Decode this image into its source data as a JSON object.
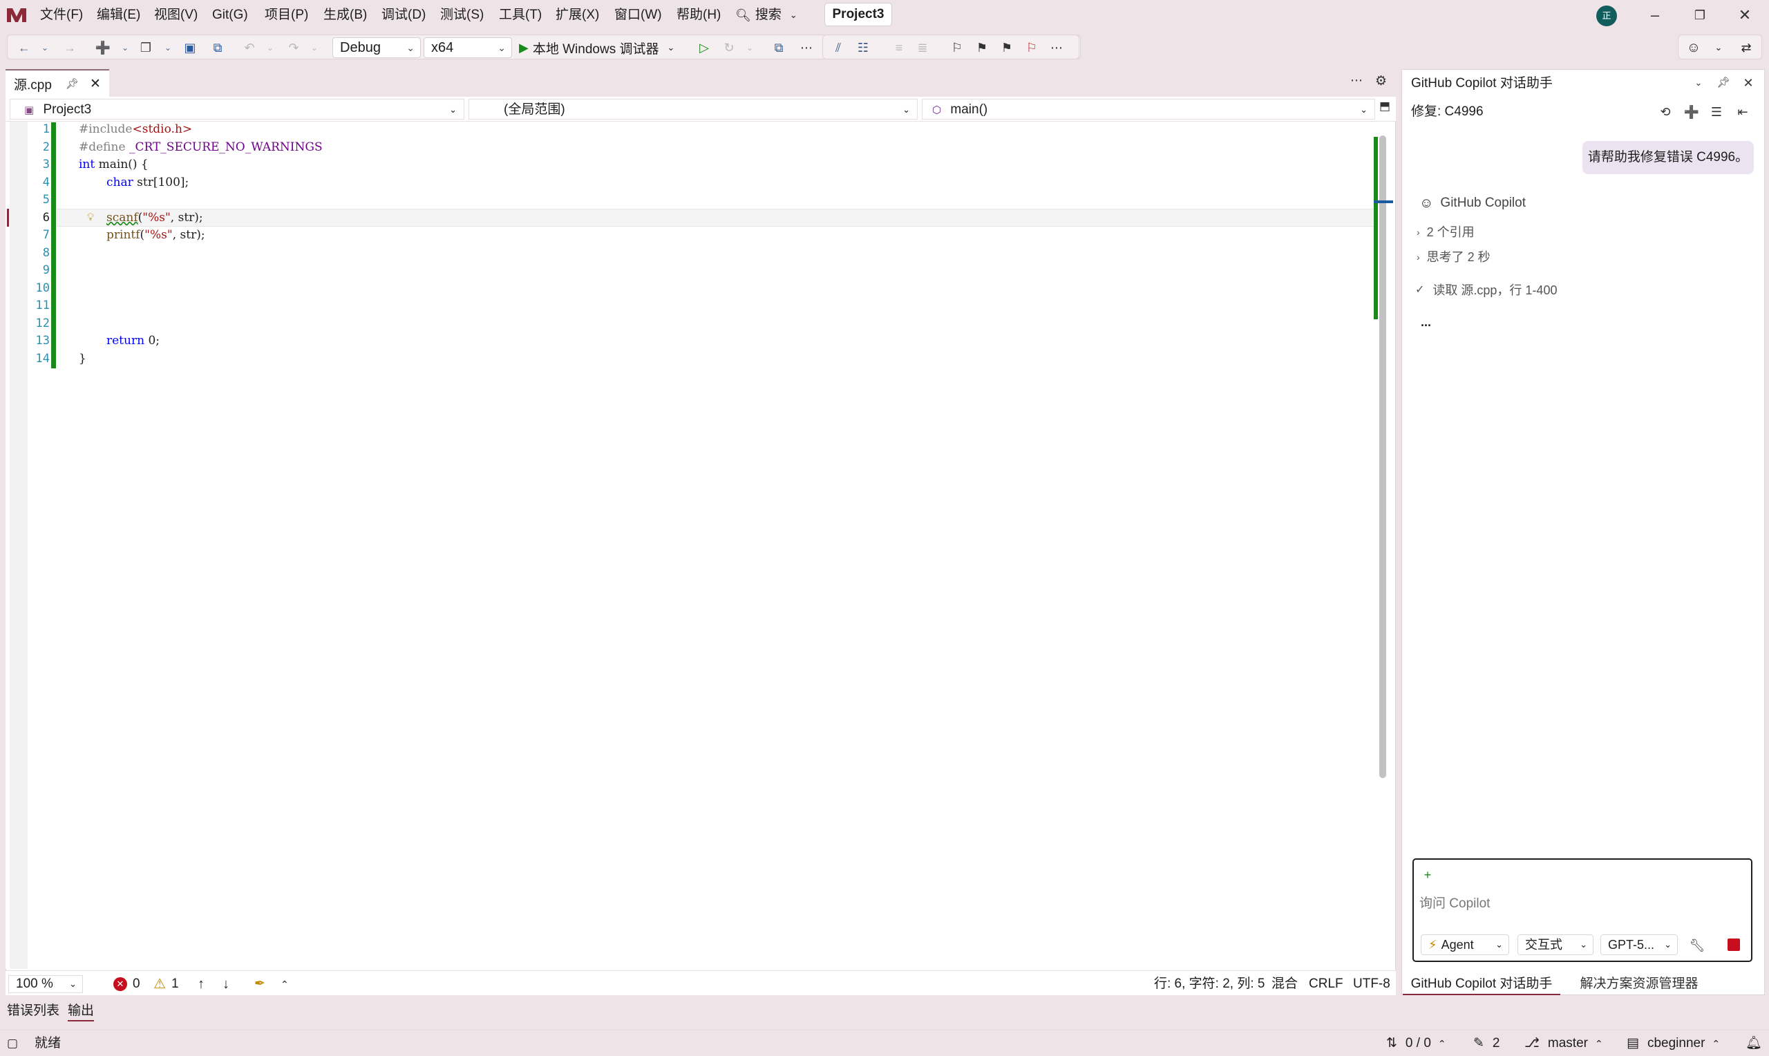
{
  "menu": {
    "items": [
      "文件(F)",
      "编辑(E)",
      "视图(V)",
      "Git(G)",
      "项目(P)",
      "生成(B)",
      "调试(D)",
      "测试(S)",
      "工具(T)",
      "扩展(X)",
      "窗口(W)",
      "帮助(H)"
    ],
    "search_label": "搜索",
    "project_name": "Project3",
    "avatar_initial": "正"
  },
  "toolbar": {
    "config": "Debug",
    "platform": "x64",
    "run_label": "本地 Windows 调试器"
  },
  "editor": {
    "tab_name": "源.cpp",
    "nav_project": "Project3",
    "nav_scope": "(全局范围)",
    "nav_member": "main()",
    "line_numbers": [
      "1",
      "2",
      "3",
      "4",
      "5",
      "6",
      "7",
      "8",
      "9",
      "10",
      "11",
      "12",
      "13",
      "14"
    ],
    "lines": {
      "l1_a": "#include",
      "l1_b": "<stdio.h>",
      "l2_a": "#define ",
      "l2_b": "_CRT_SECURE_NO_WARNINGS",
      "l3_a": "int",
      "l3_b": " main() {",
      "l4_a": "char",
      "l4_b": " str[100];",
      "l6_a": "scanf",
      "l6_b": "(",
      "l6_c": "\"%s\"",
      "l6_d": ", str);",
      "l7_a": "printf",
      "l7_b": "(",
      "l7_c": "\"%s\"",
      "l7_d": ", str);",
      "l13_a": "return",
      "l13_b": " 0;",
      "l14": "}"
    },
    "zoom": "100 %",
    "errors": "0",
    "warnings": "1",
    "position": "行: 6, 字符: 2, 列: 5",
    "mode": "混合",
    "line_ending": "CRLF",
    "encoding": "UTF-8"
  },
  "bottom_tabs": [
    "错误列表",
    "输出"
  ],
  "statusbar": {
    "ready": "就绪",
    "sync": "0 / 0",
    "pending": "2",
    "branch": "master",
    "repo": "cbeginner"
  },
  "copilot": {
    "title": "GitHub Copilot 对话助手",
    "thread": "修复: C4996",
    "user_message": "请帮助我修复错误 C4996。",
    "assistant_name": "GitHub Copilot",
    "refs": "2 个引用",
    "thought": "思考了 2 秒",
    "read_step": "读取 源.cpp，行 1-400",
    "typing": "...",
    "input_placeholder": "询问 Copilot",
    "mode_chip": "Agent",
    "interact_chip": "交互式",
    "model_chip": "GPT-5...",
    "tab_active": "GitHub Copilot 对话助手",
    "tab_other": "解决方案资源管理器"
  },
  "colors": {
    "background": "#eee3e6",
    "accent_green": "#198a19",
    "keyword": "#0000ff",
    "string": "#a31515",
    "macro": "#6f008a",
    "stop_red": "#c50f1f"
  }
}
